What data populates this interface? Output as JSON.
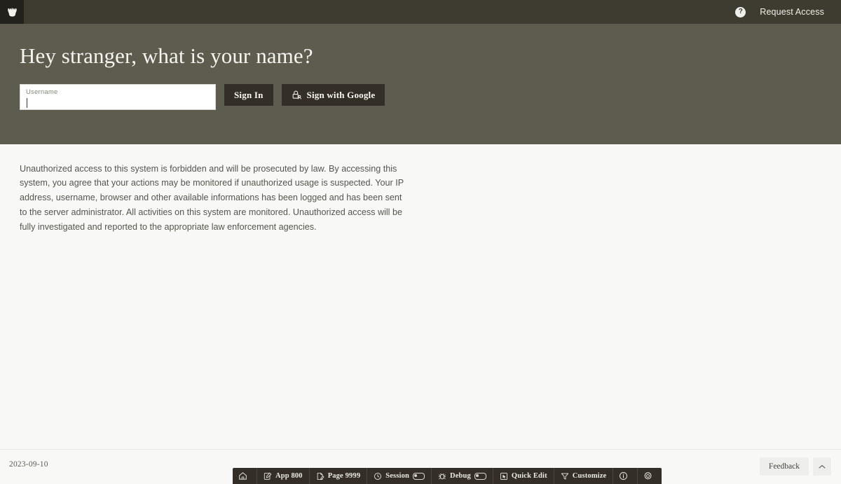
{
  "top_bar": {
    "logo_icon": "crown-logo-icon",
    "help_icon": "help-question-icon",
    "help_glyph": "?",
    "request_access_label": "Request Access"
  },
  "hero": {
    "title": "Hey stranger, what is your name?",
    "username_label": "Username",
    "username_value": "",
    "username_placeholder": "",
    "sign_in_label": "Sign In",
    "sign_with_google_label": "Sign with Google",
    "google_icon": "lock-person-icon"
  },
  "legal": {
    "text": "Unauthorized access to this system is forbidden and will be prosecuted by law. By accessing this system, you agree that your actions may be monitored if unauthorized usage is suspected. Your IP address, username, browser and other available informations has been logged and has been sent to the server administrator. All activities on this system are monitored. Unauthorized access will be fully investigated and reported to the appropriate law enforcement agencies."
  },
  "footer": {
    "date": "2023-09-10",
    "feedback_label": "Feedback",
    "collapse_icon": "chevron-up-icon"
  },
  "dev_toolbar": {
    "items": [
      {
        "icon": "home-icon",
        "label": ""
      },
      {
        "icon": "app-edit-icon",
        "label": "App 800"
      },
      {
        "icon": "page-edit-icon",
        "label": "Page 9999"
      },
      {
        "icon": "session-clock-icon",
        "label": "Session",
        "toggle": true
      },
      {
        "icon": "debug-bug-icon",
        "label": "Debug",
        "toggle": true
      },
      {
        "icon": "quick-edit-icon",
        "label": "Quick Edit"
      },
      {
        "icon": "customize-icon",
        "label": "Customize"
      },
      {
        "icon": "info-icon",
        "label": ""
      },
      {
        "icon": "gear-icon",
        "label": ""
      }
    ]
  },
  "colors": {
    "header_bg": "#3e3b31",
    "hero_bg": "#5e5b4f",
    "button_dark": "#332f28",
    "body_bg": "#f8f8f6",
    "logo_bg": "#23211c",
    "label_green": "#7e8a78"
  }
}
